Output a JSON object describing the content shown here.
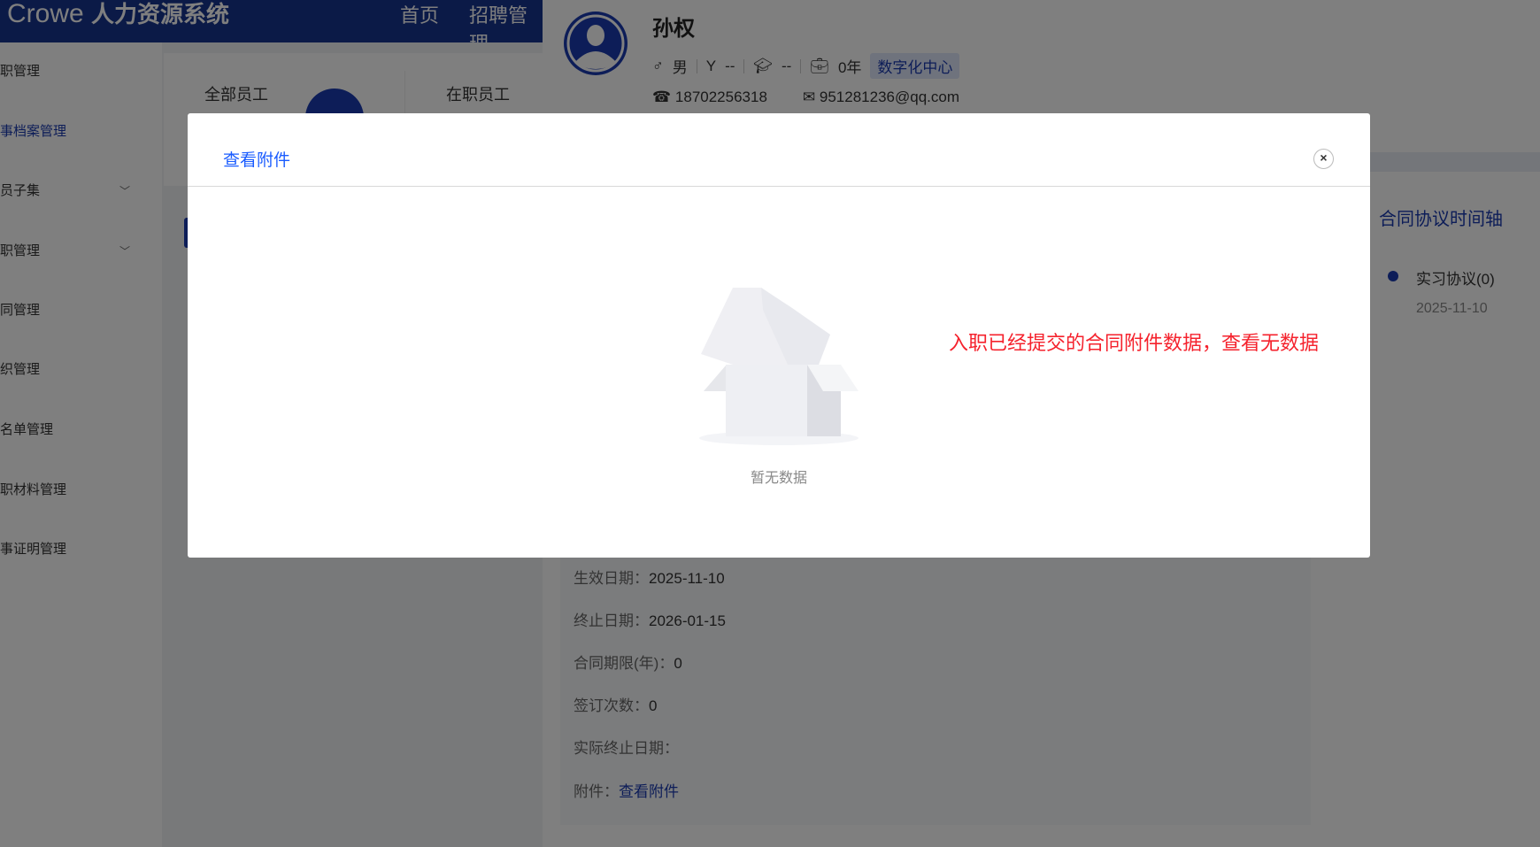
{
  "header": {
    "brand": "Crowe",
    "system": "人力资源系统",
    "nav": [
      "首页",
      "招聘管理"
    ],
    "color": "#17348f"
  },
  "sidebar": {
    "items": [
      {
        "label": "职管理"
      },
      {
        "label": "事档案管理",
        "active": true
      },
      {
        "label": "员子集",
        "chevron": true
      },
      {
        "label": "职管理",
        "chevron": true
      },
      {
        "label": "同管理"
      },
      {
        "label": "织管理"
      },
      {
        "label": "名单管理"
      },
      {
        "label": "职材料管理"
      },
      {
        "label": "事证明管理"
      }
    ]
  },
  "stats": {
    "all": "全部员工",
    "active": "在职员工"
  },
  "profile": {
    "name": "孙权",
    "gender": "男",
    "stage": "--",
    "education": "--",
    "years": "0年",
    "department": "数字化中心",
    "phone": "18702256318",
    "email": "951281236@qq.com"
  },
  "timeline": {
    "title": "合同协议时间轴",
    "items": [
      {
        "label": "实习协议(0)",
        "date": "2025-11-10"
      }
    ]
  },
  "details": [
    {
      "label": "生效日期：",
      "value": "2025-11-10"
    },
    {
      "label": "终止日期：",
      "value": "2026-01-15"
    },
    {
      "label": "合同期限(年)：",
      "value": "0"
    },
    {
      "label": "签订次数：",
      "value": "0"
    },
    {
      "label": "实际终止日期：",
      "value": ""
    },
    {
      "label": "附件：",
      "value": "查看附件",
      "link": true
    }
  ],
  "modal": {
    "title": "查看附件",
    "close": "×",
    "empty_text": "暂无数据",
    "note": "入职已经提交的合同附件数据，查看无数据",
    "note_color": "#f5222d"
  }
}
